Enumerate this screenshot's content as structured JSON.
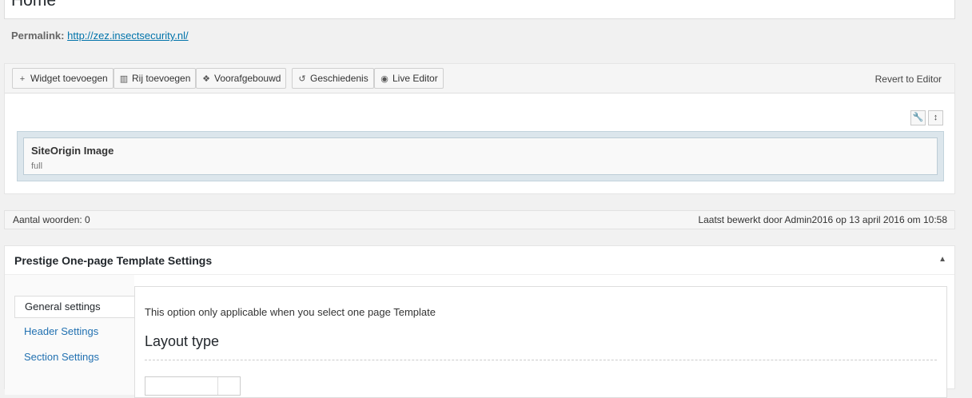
{
  "title": {
    "value": "Home"
  },
  "permalink": {
    "label": "Permalink:",
    "url": "http://zez.insectsecurity.nl/"
  },
  "builder": {
    "toolbar": [
      {
        "icon": "plus-icon",
        "glyph": "+",
        "label": "Widget toevoegen"
      },
      {
        "icon": "columns-icon",
        "glyph": "▥",
        "label": "Rij toevoegen"
      },
      {
        "icon": "prebuilt-icon",
        "glyph": "❖",
        "label": "Voorafgebouwd"
      },
      {
        "icon": "history-icon",
        "glyph": "↺",
        "label": "Geschiedenis"
      },
      {
        "icon": "eye-icon",
        "glyph": "◉",
        "label": "Live Editor"
      }
    ],
    "revert_label": "Revert to Editor",
    "row_tools": [
      {
        "icon": "wrench-icon",
        "glyph": "🔧"
      },
      {
        "icon": "move-icon",
        "glyph": "↕"
      }
    ],
    "widget": {
      "title": "SiteOrigin Image",
      "description": "full"
    }
  },
  "status": {
    "word_count": "Aantal woorden: 0",
    "last_edited": "Laatst bewerkt door Admin2016 op 13 april 2016 om 10:58"
  },
  "settings": {
    "title": "Prestige One-page Template Settings",
    "tabs": [
      "General settings",
      "Header Settings",
      "Section Settings"
    ],
    "panel_note": "This option only applicable when you select one page Template",
    "panel_heading": "Layout type"
  },
  "colors": {
    "accent": "#0073aa",
    "link": "#2271b1",
    "cell_bg": "#dce6ec"
  }
}
